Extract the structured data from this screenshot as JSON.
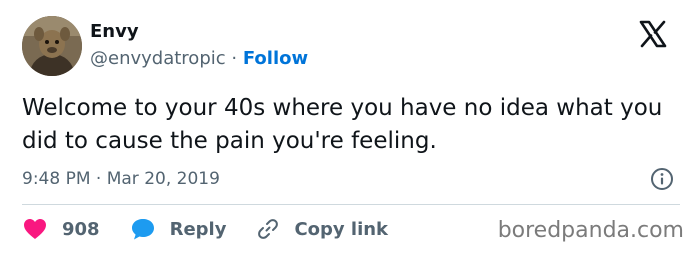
{
  "author": {
    "display_name": "Envy",
    "handle": "@envydatropic",
    "separator": "·",
    "follow_label": "Follow"
  },
  "tweet": {
    "text": "Welcome to your 40s where you have no idea what you did to cause the pain you're feeling.",
    "timestamp": "9:48 PM · Mar 20, 2019"
  },
  "actions": {
    "like_count": "908",
    "reply_label": "Reply",
    "copy_link_label": "Copy link"
  },
  "watermark": "boredpanda.com",
  "icons": {
    "like": "heart-icon",
    "reply": "speech-bubble-icon",
    "copy_link": "link-icon",
    "platform": "x-logo-icon",
    "info": "info-icon"
  },
  "colors": {
    "follow": "#0074d9",
    "like": "#f91880",
    "reply": "#1d9bf0",
    "secondary_text": "#536471"
  }
}
